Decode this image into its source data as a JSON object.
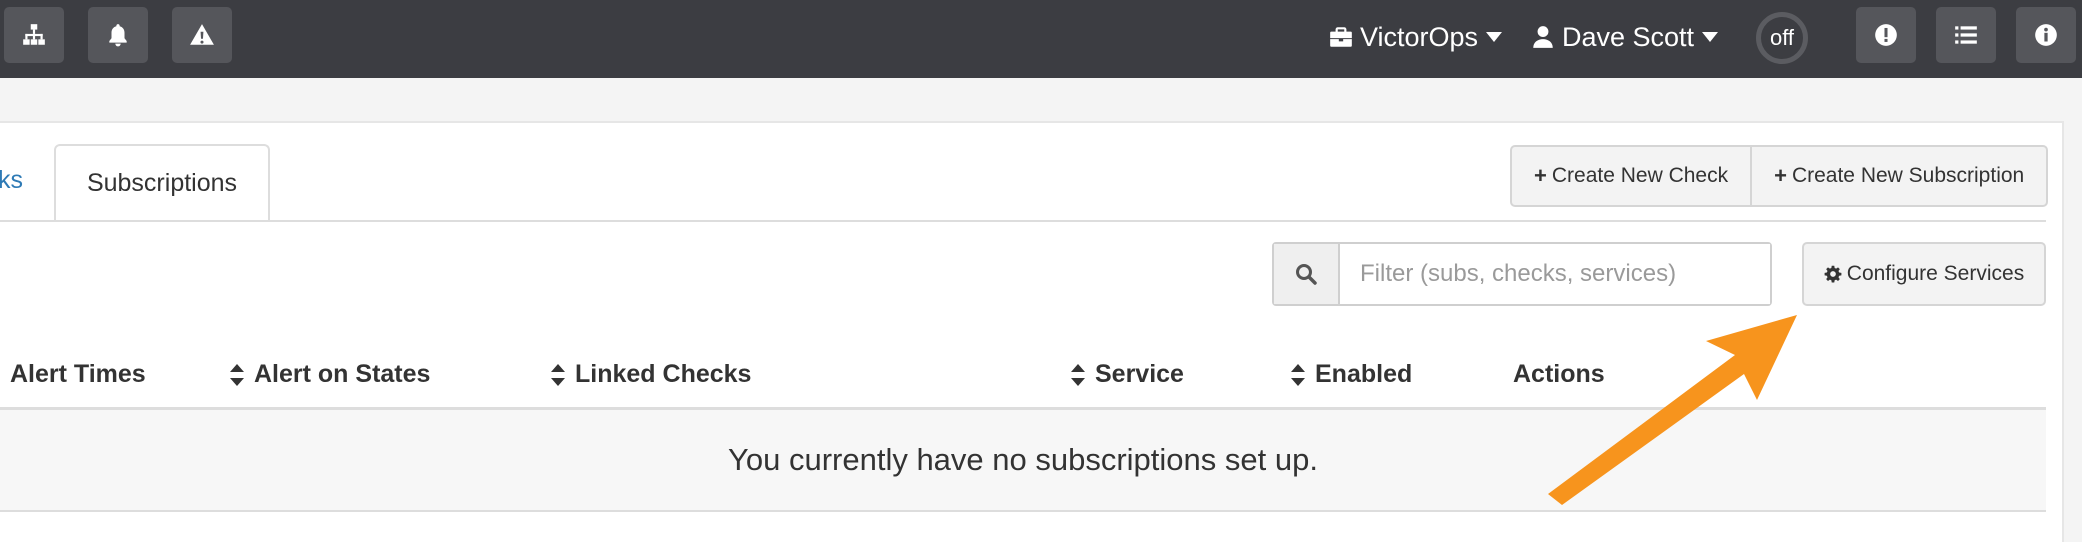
{
  "navbar": {
    "icons": [
      "sitemap-icon",
      "bell-icon",
      "warning-icon"
    ],
    "org_menu": {
      "label": "VictorOps",
      "icon": "briefcase-icon"
    },
    "user_menu": {
      "label": "Dave Scott",
      "icon": "user-icon"
    },
    "status_toggle": "off",
    "right_icons": [
      "exclamation-icon",
      "list-icon",
      "info-icon"
    ]
  },
  "tabs": {
    "previous_partial": "ks",
    "active": "Subscriptions"
  },
  "actions": {
    "create_check": "Create New Check",
    "create_subscription": "Create New Subscription",
    "plus_glyph": "+"
  },
  "filter": {
    "placeholder": "Filter (subs, checks, services)",
    "value": ""
  },
  "configure_services": "Configure Services",
  "table": {
    "columns": [
      {
        "label": "Alert Times",
        "sortable": false
      },
      {
        "label": "Alert on States",
        "sortable": true
      },
      {
        "label": "Linked Checks",
        "sortable": true
      },
      {
        "label": "Service",
        "sortable": true
      },
      {
        "label": "Enabled",
        "sortable": true
      },
      {
        "label": "Actions",
        "sortable": false
      }
    ],
    "empty_message": "You currently have no subscriptions set up."
  },
  "colors": {
    "navbar": "#3c3d42",
    "nav_button": "#55565b",
    "link": "#2e7ab5",
    "annotation_arrow": "#f7941d"
  }
}
